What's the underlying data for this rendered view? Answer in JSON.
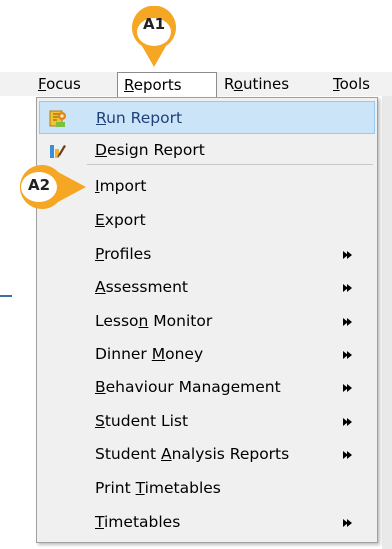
{
  "callouts": {
    "a1": "A1",
    "a2": "A2"
  },
  "menubar": {
    "items": [
      {
        "pre": "",
        "u": "F",
        "post": "ocus"
      },
      {
        "pre": "",
        "u": "R",
        "post": "eports"
      },
      {
        "pre": "R",
        "u": "o",
        "post": "utines"
      },
      {
        "pre": "",
        "u": "T",
        "post": "ools"
      }
    ]
  },
  "menu": {
    "items": [
      {
        "pre": "",
        "u": "R",
        "post": "un Report",
        "icon": "run-report-icon",
        "submenu": false
      },
      {
        "pre": "",
        "u": "D",
        "post": "esign Report",
        "icon": "design-report-icon",
        "submenu": false
      },
      {
        "pre": "",
        "u": "I",
        "post": "mport",
        "submenu": false
      },
      {
        "pre": "",
        "u": "E",
        "post": "xport",
        "submenu": false
      },
      {
        "pre": "",
        "u": "P",
        "post": "rofiles",
        "submenu": true
      },
      {
        "pre": "",
        "u": "A",
        "post": "ssessment",
        "submenu": true
      },
      {
        "pre": "Lesso",
        "u": "n",
        "post": " Monitor",
        "submenu": true
      },
      {
        "pre": "Dinner ",
        "u": "M",
        "post": "oney",
        "submenu": true
      },
      {
        "pre": "",
        "u": "B",
        "post": "ehaviour Management",
        "submenu": true
      },
      {
        "pre": "",
        "u": "S",
        "post": "tudent List",
        "submenu": true
      },
      {
        "pre": "Student ",
        "u": "A",
        "post": "nalysis Reports",
        "submenu": true
      },
      {
        "pre": "Print ",
        "u": "T",
        "post": "imetables",
        "submenu": false
      },
      {
        "pre": "",
        "u": "T",
        "post": "imetables",
        "submenu": true
      }
    ]
  },
  "colors": {
    "callout": "#f5a623",
    "highlight": "#cce4f7",
    "highlight_border": "#99c9ef"
  }
}
